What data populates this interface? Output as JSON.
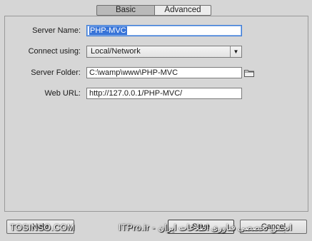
{
  "tabs": {
    "basic": "Basic",
    "advanced": "Advanced"
  },
  "form": {
    "server_name": {
      "label": "Server Name:",
      "value": "PHP-MVC"
    },
    "connect_using": {
      "label": "Connect using:",
      "value": "Local/Network"
    },
    "server_folder": {
      "label": "Server Folder:",
      "value": "C:\\wamp\\www\\PHP-MVC"
    },
    "web_url": {
      "label": "Web URL:",
      "value": "http://127.0.0.1/PHP-MVC/"
    }
  },
  "buttons": {
    "help": "Help",
    "save": "Save",
    "cancel": "Cancel"
  },
  "watermark": {
    "left": "TOSINSO.COM",
    "right": "ITPro.ir - انجمن تخصصی فناوری اطلاعات ایران"
  },
  "colors": {
    "accent": "#3874d8",
    "background": "#d6d6d6"
  }
}
